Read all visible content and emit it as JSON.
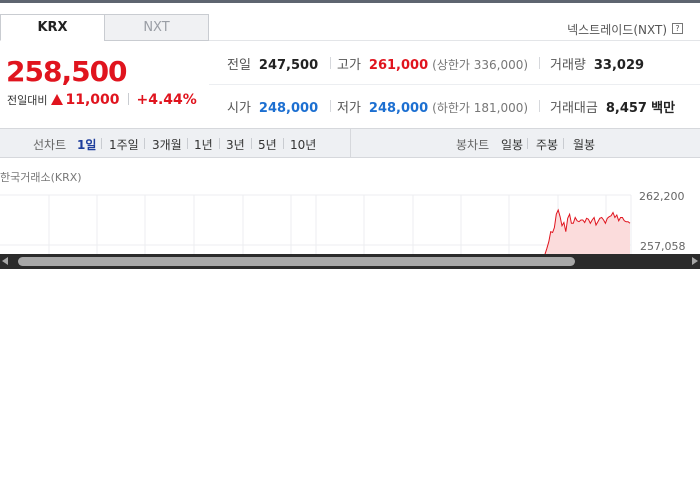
{
  "tabs": [
    {
      "label": "KRX",
      "active": true
    },
    {
      "label": "NXT",
      "active": false
    }
  ],
  "nxt_link": "넥스트레이드(NXT)",
  "help_glyph": "?",
  "price": {
    "current": "258,500",
    "change_label": "전일대비",
    "change_amount": "11,000",
    "change_percent": "+4.44%",
    "direction": "up"
  },
  "stats": {
    "prev_close": {
      "label": "전일",
      "value": "247,500"
    },
    "high": {
      "label": "고가",
      "value": "261,000",
      "limit_label": "(상한가 336,000)"
    },
    "volume": {
      "label": "거래량",
      "value": "33,029"
    },
    "open": {
      "label": "시가",
      "value": "248,000"
    },
    "low": {
      "label": "저가",
      "value": "248,000",
      "limit_label": "(하한가 181,000)"
    },
    "trade_value": {
      "label": "거래대금",
      "value": "8,457",
      "unit": "백만"
    }
  },
  "chart_toolbar": {
    "line_chart_title": "선차트",
    "line_periods": [
      "1일",
      "1주일",
      "3개월",
      "1년",
      "3년",
      "5년",
      "10년"
    ],
    "selected_period": "1일",
    "candle_chart_title": "봉차트",
    "candle_periods": [
      "일봉",
      "주봉",
      "월봉"
    ]
  },
  "exchange_label": "한국거래소(KRX)",
  "colors": {
    "up": "#e0141e",
    "down": "#1c6fd1",
    "selected": "#1d3d9c"
  },
  "chart_data": {
    "type": "area",
    "title": "",
    "xlabel": "",
    "ylabel": "",
    "y_tick_labels": [
      "262,200",
      "257,058"
    ],
    "ylim": [
      255800,
      263000
    ],
    "x": [
      0,
      1,
      2,
      3,
      4,
      5,
      6,
      7,
      8,
      9,
      10,
      11,
      12,
      13,
      14,
      15,
      16,
      17,
      18,
      19,
      20,
      21,
      22,
      23,
      24,
      25,
      26,
      27,
      28,
      29,
      30,
      31,
      32,
      33,
      34,
      35,
      36,
      37,
      38,
      39,
      40,
      41,
      42,
      43,
      44,
      45
    ],
    "values": [
      255900,
      256600,
      257400,
      258600,
      258500,
      259100,
      260700,
      261200,
      260400,
      259300,
      259700,
      258600,
      260200,
      260700,
      259600,
      259600,
      260300,
      259900,
      259800,
      260000,
      260000,
      259700,
      260200,
      260100,
      259600,
      260000,
      260300,
      259400,
      259800,
      260200,
      260300,
      260000,
      259600,
      260200,
      260400,
      260500,
      260900,
      260300,
      260600,
      259900,
      260300,
      260300,
      259900,
      259800,
      259800,
      259600
    ],
    "grid": true,
    "color": "#e0141e"
  }
}
